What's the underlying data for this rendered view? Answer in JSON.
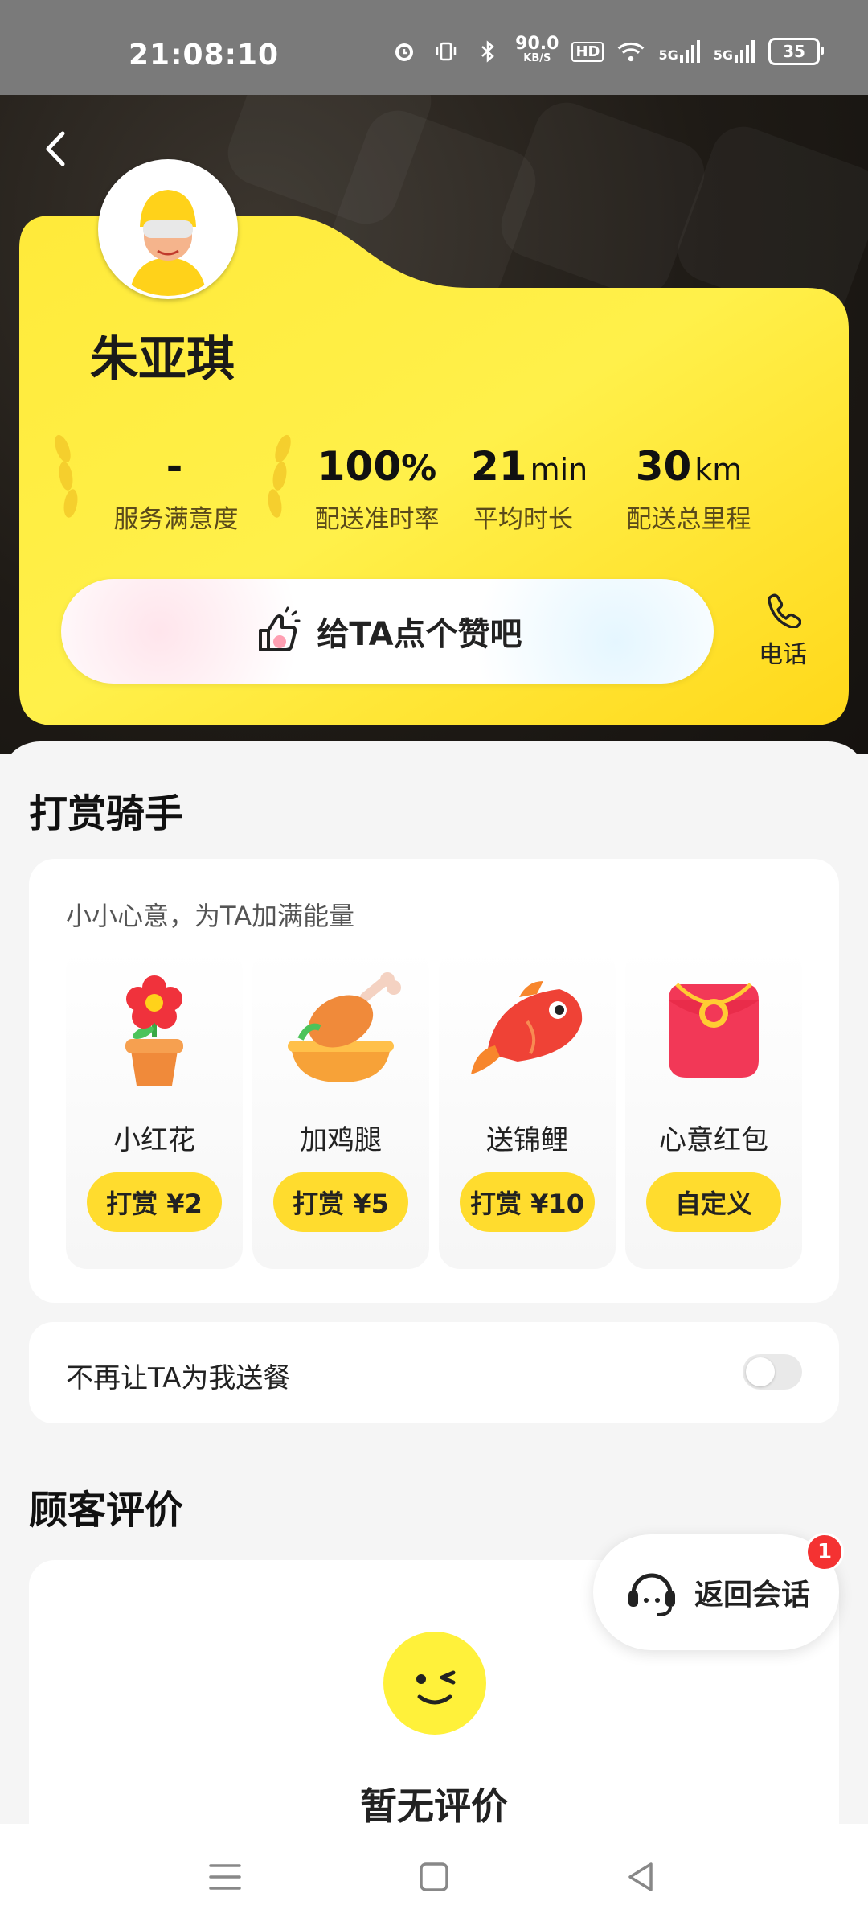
{
  "status_bar": {
    "time": "21:08:10",
    "net_speed_top": "90.0",
    "net_speed_unit": "KB/S",
    "hd_label": "HD",
    "signal1": "5G",
    "signal2": "5G",
    "battery": "35"
  },
  "rider": {
    "name": "朱亚琪",
    "stats": [
      {
        "value": "-",
        "unit": "",
        "label": "服务满意度"
      },
      {
        "value": "100",
        "unit": "%",
        "label": "配送准时率"
      },
      {
        "value": "21",
        "unit": "min",
        "label": "平均时长"
      },
      {
        "value": "30",
        "unit": "km",
        "label": "配送总里程"
      }
    ],
    "like_button": "给TA点个赞吧",
    "phone_label": "电话"
  },
  "tip": {
    "section_title": "打赏骑手",
    "subtitle": "小小心意，为TA加满能量",
    "gifts": [
      {
        "name": "小红花",
        "button": "打赏 ¥2",
        "icon": "flower-icon"
      },
      {
        "name": "加鸡腿",
        "button": "打赏 ¥5",
        "icon": "drumstick-icon"
      },
      {
        "name": "送锦鲤",
        "button": "打赏 ¥10",
        "icon": "koi-icon"
      },
      {
        "name": "心意红包",
        "button": "自定义",
        "icon": "red-envelope-icon"
      }
    ]
  },
  "no_deliver": {
    "label": "不再让TA为我送餐",
    "enabled": false
  },
  "reviews": {
    "section_title": "顾客评价",
    "empty_text": "暂无评价"
  },
  "return_chat": {
    "label": "返回会话",
    "badge": "1"
  },
  "colors": {
    "accent": "#FFDC2E",
    "badge": "#F43232"
  }
}
